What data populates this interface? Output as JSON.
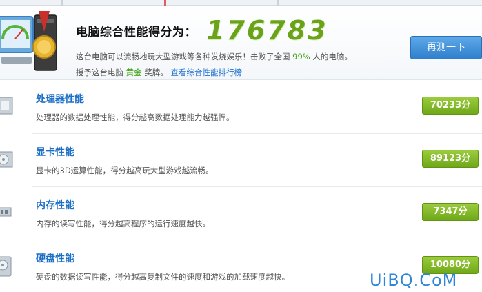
{
  "header": {
    "title": "电脑综合性能得分为：",
    "total_score": "176783",
    "desc1_prefix": "这台电脑可以流畅地玩大型游戏等各种发烧娱乐！击败了全国",
    "desc1_percent": "99%",
    "desc1_suffix": "人的电脑。",
    "desc2_prefix": "授予这台电脑",
    "desc2_medal": "黄金",
    "desc2_suffix": "奖牌。",
    "ranking_link": "查看综合性能排行榜",
    "retest_label": "再测一下"
  },
  "items": [
    {
      "name": "处理器性能",
      "desc": "处理器的数据处理性能，得分越高数据处理能力越强悍。",
      "score": "70233分",
      "icon": "cpu-icon"
    },
    {
      "name": "显卡性能",
      "desc": "显卡的3D运算性能，得分越高玩大型游戏越流畅。",
      "score": "89123分",
      "icon": "graphics-card-icon"
    },
    {
      "name": "内存性能",
      "desc": "内存的读写性能，得分越高程序的运行速度越快。",
      "score": "7347分",
      "icon": "memory-icon"
    },
    {
      "name": "硬盘性能",
      "desc": "硬盘的数据读写性能，得分越高复制文件的速度和游戏的加载速度越快。",
      "score": "10080分",
      "icon": "hard-disk-icon"
    }
  ],
  "watermark": "UiBQ.CoM",
  "colors": {
    "score_green": "#6aa318",
    "link_blue": "#1c6fc6",
    "badge_green": "#7fb522",
    "button_blue": "#3d8bd8"
  }
}
